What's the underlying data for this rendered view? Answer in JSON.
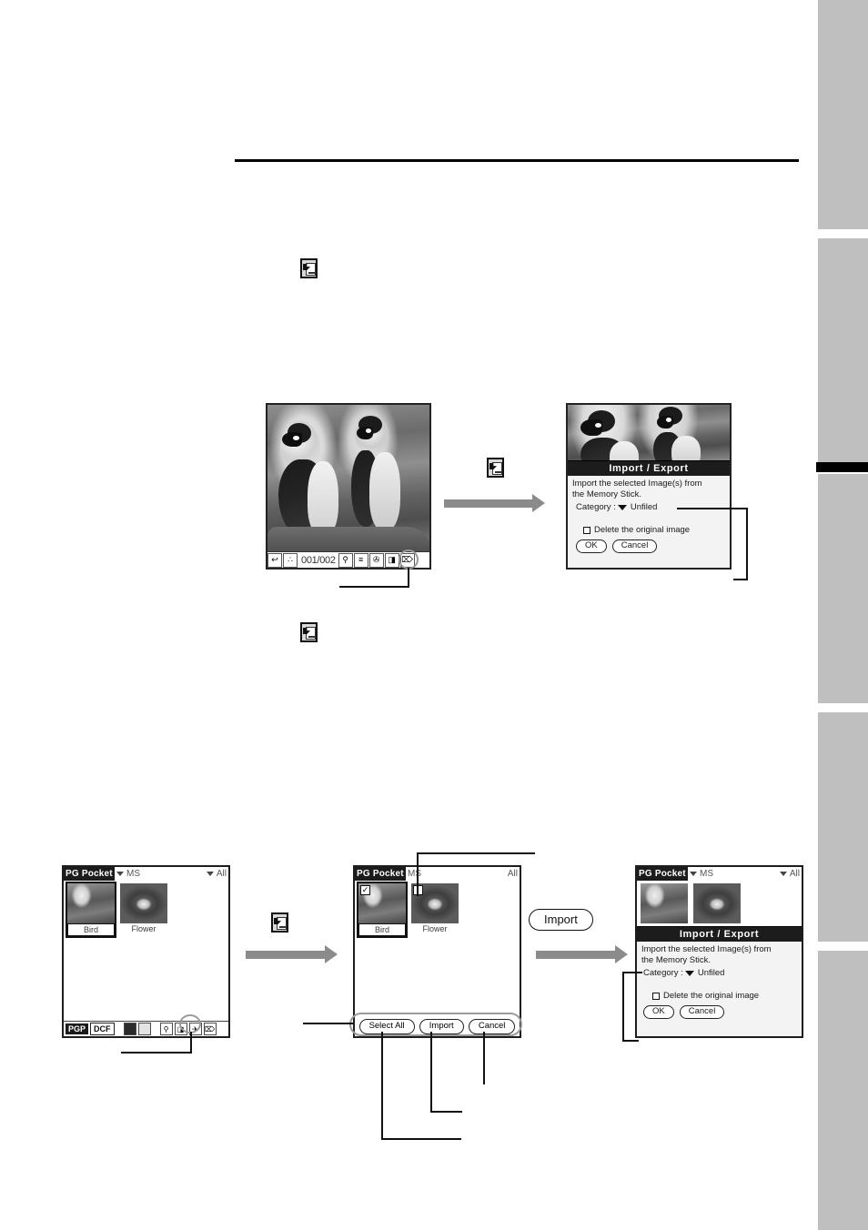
{
  "page": {
    "rule_present": true
  },
  "icons": {
    "import_export": "import-export-icon",
    "import_export_label": "Import / Export icon"
  },
  "photo_viewer": {
    "counter": "001/002",
    "toolbar": [
      {
        "name": "back-icon",
        "glyph": "↩"
      },
      {
        "name": "thumbnail-icon",
        "glyph": "∴"
      },
      {
        "name": "page-counter",
        "glyph": "001/002"
      },
      {
        "name": "zoom-icon",
        "glyph": "⚲"
      },
      {
        "name": "details-icon",
        "glyph": "≡"
      },
      {
        "name": "beam-icon",
        "glyph": "✇"
      },
      {
        "name": "import-export-icon",
        "glyph": "◨"
      },
      {
        "name": "delete-icon",
        "glyph": "⌦"
      }
    ]
  },
  "dialog_top": {
    "title": "Import / Export",
    "body_line1": "Import the selected Image(s) from",
    "body_line2": "the Memory Stick.",
    "category_label": "Category :",
    "category_value": "Unfiled",
    "checkbox_label": "Delete the original image",
    "ok_label": "OK",
    "cancel_label": "Cancel"
  },
  "pg_pocket_1": {
    "app_name": "PG Pocket",
    "source_picker": "MS",
    "category_picker": "All",
    "thumbnails": [
      {
        "label": "Bird",
        "selected": true
      },
      {
        "label": "Flower",
        "selected": false
      }
    ],
    "format_tabs": [
      {
        "label": "PGP",
        "active": true
      },
      {
        "label": "DCF",
        "active": false
      }
    ],
    "toolbar": [
      {
        "name": "grid-view-icon",
        "glyph": "▒"
      },
      {
        "name": "list-view-icon",
        "glyph": "≡"
      },
      {
        "name": "search-icon",
        "glyph": "⚲"
      },
      {
        "name": "import-export-icon",
        "glyph": "◨"
      },
      {
        "name": "beam-icon",
        "glyph": "✈"
      },
      {
        "name": "delete-icon",
        "glyph": "⌦"
      }
    ]
  },
  "pg_pocket_2": {
    "app_name": "PG Pocket",
    "source_picker": "MS",
    "category_picker": "All",
    "thumbnails": [
      {
        "label": "Bird",
        "selected": true,
        "checked": true
      },
      {
        "label": "Flower",
        "selected": false,
        "checked": false
      }
    ],
    "buttons": [
      {
        "name": "select-all-button",
        "label": "Select All"
      },
      {
        "name": "import-button",
        "label": "Import"
      },
      {
        "name": "cancel-button",
        "label": "Cancel"
      }
    ]
  },
  "pg_pocket_3": {
    "app_name": "PG Pocket",
    "source_picker": "MS",
    "category_picker": "All",
    "dialog": {
      "title": "Import / Export",
      "body_line1": "Import the selected Image(s) from",
      "body_line2": "the Memory Stick.",
      "category_label": "Category :",
      "category_value": "Unfiled",
      "checkbox_label": "Delete the original image",
      "ok_label": "OK",
      "cancel_label": "Cancel"
    }
  },
  "callout_pill": {
    "label": "Import"
  },
  "colors": {
    "margin_tab": "#bfbfbf",
    "arrow": "#8b8b8b",
    "title_bar": "#1c1c1c",
    "highlight_ring": "#9a9a9a"
  }
}
